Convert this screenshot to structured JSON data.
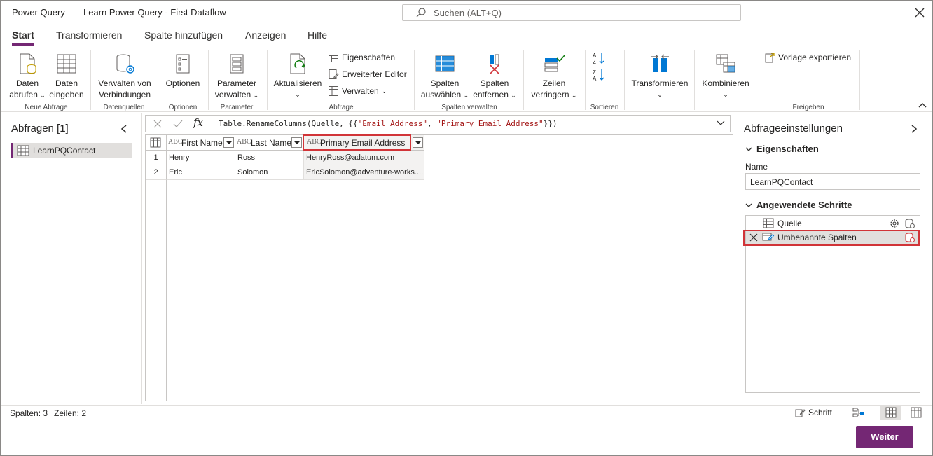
{
  "titlebar": {
    "app_name": "Power Query",
    "doc_title": "Learn Power Query - First Dataflow",
    "search_placeholder": "Suchen (ALT+Q)"
  },
  "tabs": [
    {
      "label": "Start"
    },
    {
      "label": "Transformieren"
    },
    {
      "label": "Spalte hinzufügen"
    },
    {
      "label": "Anzeigen"
    },
    {
      "label": "Hilfe"
    }
  ],
  "ribbon": {
    "daten_abrufen": {
      "line1": "Daten",
      "line2": "abrufen"
    },
    "daten_eingeben": {
      "line1": "Daten",
      "line2": "eingeben"
    },
    "group_neue_abfrage": "Neue Abfrage",
    "verwalten_verbindungen": {
      "line1": "Verwalten von",
      "line2": "Verbindungen"
    },
    "group_datenquellen": "Datenquellen",
    "optionen": "Optionen",
    "group_optionen": "Optionen",
    "parameter_verwalten": {
      "line1": "Parameter",
      "line2": "verwalten"
    },
    "group_parameter": "Parameter",
    "aktualisieren": "Aktualisieren",
    "eigenschaften": "Eigenschaften",
    "erweiterter_editor": "Erweiterter Editor",
    "verwalten": "Verwalten",
    "group_abfrage": "Abfrage",
    "spalten_auswaehlen": {
      "line1": "Spalten",
      "line2": "auswählen"
    },
    "spalten_entfernen": {
      "line1": "Spalten",
      "line2": "entfernen"
    },
    "group_spalten_verwalten": "Spalten verwalten",
    "zeilen_verringern": {
      "line1": "Zeilen",
      "line2": "verringern"
    },
    "group_sortieren": "Sortieren",
    "transformieren": "Transformieren",
    "kombinieren": "Kombinieren",
    "vorlage_exportieren": "Vorlage exportieren",
    "group_freigeben": "Freigeben"
  },
  "left_pane": {
    "title": "Abfragen [1]",
    "queries": [
      {
        "label": "LearnPQContact"
      }
    ]
  },
  "formula_bar": {
    "prefix": "Table.RenameColumns(Quelle, {{",
    "s1": "\"Email Address\"",
    "mid": ", ",
    "s2": "\"Primary Email Address\"",
    "suffix": "}})"
  },
  "table": {
    "columns": [
      {
        "type": "ABC",
        "label": "First Name"
      },
      {
        "type": "ABC",
        "label": "Last Name"
      },
      {
        "type": "ABC",
        "label": "Primary Email Address"
      }
    ],
    "rows": [
      {
        "n": "1",
        "c": [
          "Henry",
          "Ross",
          "HenryRoss@adatum.com"
        ]
      },
      {
        "n": "2",
        "c": [
          "Eric",
          "Solomon",
          "EricSolomon@adventure-works...."
        ]
      }
    ]
  },
  "right_pane": {
    "title": "Abfrageeinstellungen",
    "properties_label": "Eigenschaften",
    "name_label": "Name",
    "name_value": "LearnPQContact",
    "steps_label": "Angewendete Schritte",
    "steps": [
      {
        "label": "Quelle"
      },
      {
        "label": "Umbenannte Spalten"
      }
    ]
  },
  "status": {
    "columns": "Spalten: 3",
    "rows": "Zeilen: 2",
    "schritt": "Schritt"
  },
  "footer": {
    "weiter": "Weiter"
  },
  "colors": {
    "accent": "#742774",
    "highlight": "#d13438"
  }
}
